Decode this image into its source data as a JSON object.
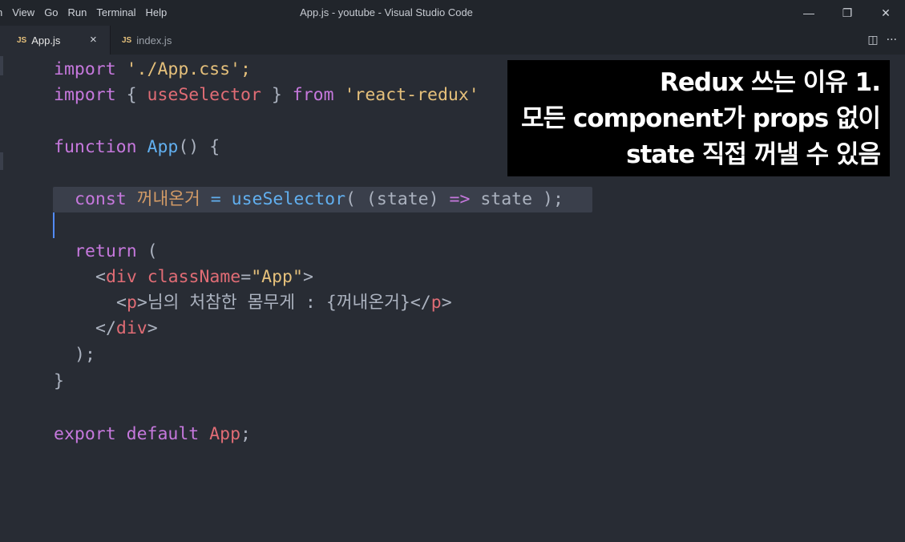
{
  "titlebar": {
    "menu": [
      "n",
      "View",
      "Go",
      "Run",
      "Terminal",
      "Help"
    ],
    "title": "App.js - youtube - Visual Studio Code",
    "minimize": "—",
    "restore": "❐",
    "close": "✕"
  },
  "tabs": [
    {
      "badge": "JS",
      "label": "App.js",
      "close": "×"
    },
    {
      "badge": "JS",
      "label": "index.js"
    }
  ],
  "tab_actions": {
    "split": "◫",
    "more": "···"
  },
  "code": {
    "l1": {
      "a": "import",
      "b": " './App.css';"
    },
    "l2": {
      "a": "import",
      "b": " { ",
      "c": "useSelector",
      "d": " } ",
      "e": "from",
      "f": " 'react-redux'"
    },
    "l4": {
      "a": "function",
      "b": " ",
      "c": "App",
      "d": "() {"
    },
    "l6": {
      "a": "const",
      "b": " ",
      "c": "꺼내온거",
      "d": " = ",
      "e": "useSelector",
      "f": "( (state) ",
      "g": "=>",
      "h": " state );"
    },
    "l8": {
      "a": "return",
      "b": " ("
    },
    "l9": {
      "a": "<",
      "b": "div",
      "c": " className",
      "d": "=",
      "e": "\"App\"",
      "f": ">"
    },
    "l10": {
      "a": "<",
      "b": "p",
      "c": ">",
      "d": "님의 처참한 몸무게 : {꺼내온거}",
      "e": "</",
      "f": "p",
      "g": ">"
    },
    "l11": {
      "a": "</",
      "b": "div",
      "c": ">"
    },
    "l12": ");",
    "l13": "}",
    "l15": {
      "a": "export",
      "b": " ",
      "c": "default",
      "d": " App",
      "e": ";"
    }
  },
  "caption": {
    "line1": "Redux 쓰는 이유 1.",
    "line2": "모든 component가 props 없이",
    "line3": "state 직접 꺼낼 수 있음"
  },
  "colors": {
    "editor_bg": "#282c34",
    "titlebar_bg": "#21252b",
    "keyword": "#c678dd",
    "string": "#e5c07b",
    "function": "#61afef",
    "identifier": "#e06c75"
  }
}
